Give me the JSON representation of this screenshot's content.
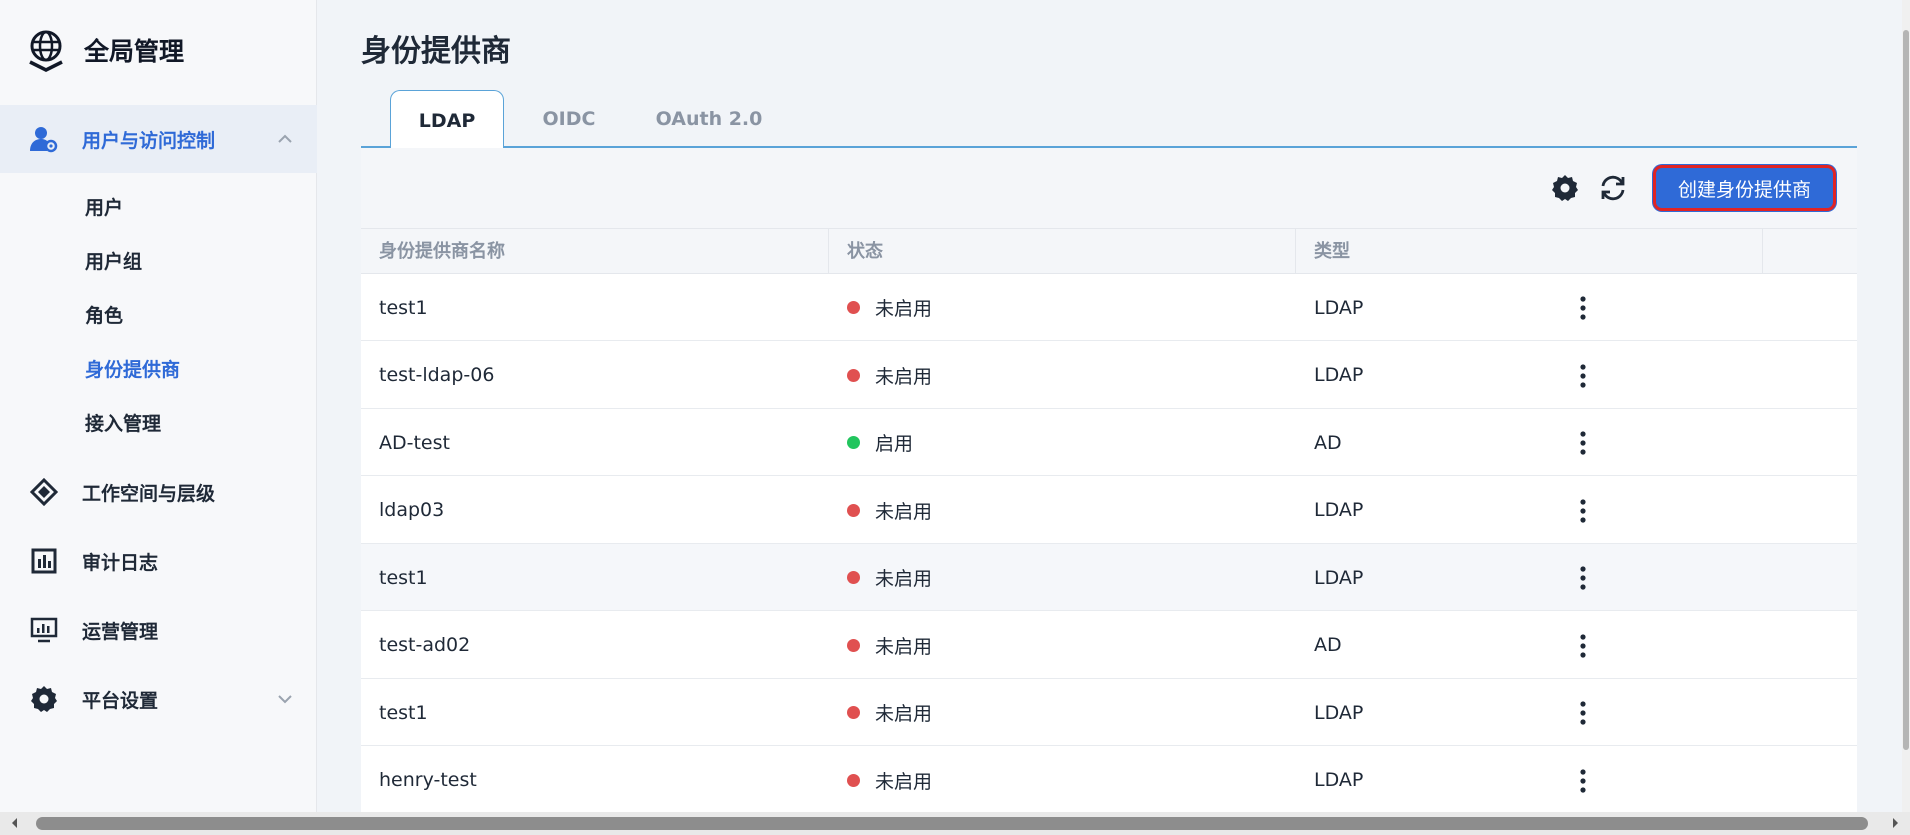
{
  "app": {
    "title": "全局管理"
  },
  "sidebar": {
    "groups": [
      {
        "label": "用户与访问控制",
        "icon": "user-access-icon",
        "expanded": true
      },
      {
        "label": "工作空间与层级",
        "icon": "workspace-icon"
      },
      {
        "label": "审计日志",
        "icon": "audit-log-icon"
      },
      {
        "label": "运营管理",
        "icon": "operations-icon"
      },
      {
        "label": "平台设置",
        "icon": "gear-icon",
        "expanded": false
      }
    ],
    "sub_items": [
      "用户",
      "用户组",
      "角色",
      "身份提供商",
      "接入管理"
    ],
    "active_sub": "身份提供商"
  },
  "page": {
    "title": "身份提供商"
  },
  "tabs": [
    {
      "label": "LDAP",
      "active": true
    },
    {
      "label": "OIDC",
      "active": false
    },
    {
      "label": "OAuth 2.0",
      "active": false
    }
  ],
  "toolbar": {
    "settings_icon": "gear-icon",
    "refresh_icon": "refresh-icon",
    "create_label": "创建身份提供商"
  },
  "table": {
    "columns": [
      "身份提供商名称",
      "状态",
      "类型",
      ""
    ],
    "rows": [
      {
        "name": "test1",
        "status": "未启用",
        "status_color": "#e05050",
        "type": "LDAP"
      },
      {
        "name": "test-ldap-06",
        "status": "未启用",
        "status_color": "#e05050",
        "type": "LDAP"
      },
      {
        "name": "AD-test",
        "status": "启用",
        "status_color": "#22c55e",
        "type": "AD"
      },
      {
        "name": "ldap03",
        "status": "未启用",
        "status_color": "#e05050",
        "type": "LDAP"
      },
      {
        "name": "test1",
        "status": "未启用",
        "status_color": "#e05050",
        "type": "LDAP"
      },
      {
        "name": "test-ad02",
        "status": "未启用",
        "status_color": "#e05050",
        "type": "AD"
      },
      {
        "name": "test1",
        "status": "未启用",
        "status_color": "#e05050",
        "type": "LDAP"
      },
      {
        "name": "henry-test",
        "status": "未启用",
        "status_color": "#e05050",
        "type": "LDAP"
      }
    ]
  },
  "colors": {
    "accent": "#2f6ad7",
    "disabled": "#e05050",
    "enabled": "#22c55e",
    "highlight": "#e02424"
  }
}
